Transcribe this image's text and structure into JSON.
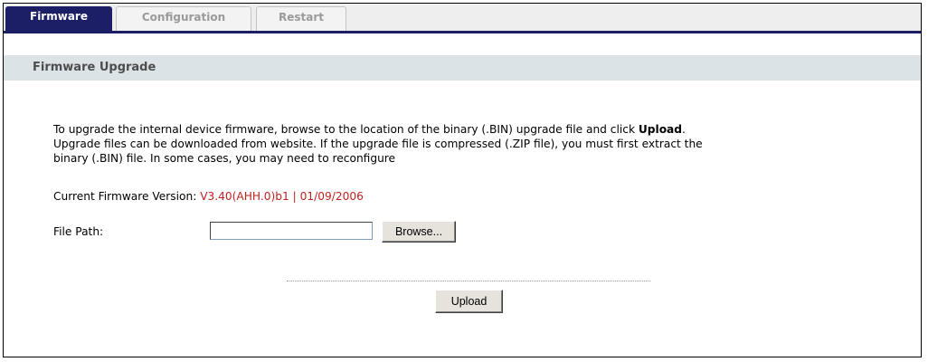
{
  "tabs": [
    {
      "label": "Firmware",
      "active": true
    },
    {
      "label": "Configuration",
      "active": false
    },
    {
      "label": "Restart",
      "active": false
    }
  ],
  "section_title": "Firmware Upgrade",
  "description": {
    "line1_prefix": "To upgrade the internal device firmware, browse to the location of the binary (.BIN) upgrade file and click ",
    "line1_bold": "Upload",
    "line1_suffix": ".",
    "line2": "Upgrade files can be downloaded from website. If the upgrade file is compressed (.ZIP file), you must first extract the",
    "line3": "binary (.BIN) file. In some cases, you may need to reconfigure"
  },
  "firmware": {
    "label": "Current Firmware Version:",
    "value": "V3.40(AHH.0)b1 | 01/09/2006"
  },
  "file_path": {
    "label": "File Path:",
    "value": "",
    "browse_label": "Browse..."
  },
  "upload_label": "Upload",
  "colors": {
    "tab_active_bg": "#1d1f66",
    "section_bar_bg": "#dbe3e6",
    "version_text": "#c0211f"
  }
}
